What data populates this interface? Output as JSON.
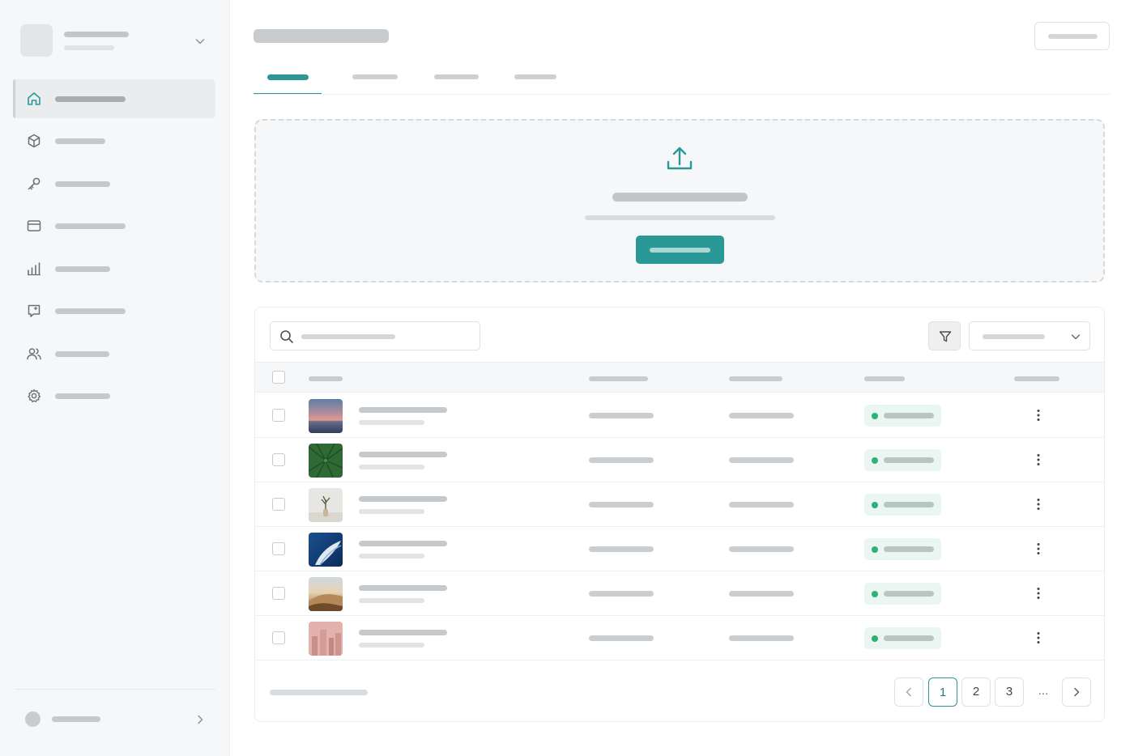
{
  "page": {
    "title": "",
    "primary_action_label": ""
  },
  "sidebar": {
    "workspace": {
      "name": "",
      "subtitle": "",
      "expand_icon": "chevron-down-icon"
    },
    "items": [
      {
        "icon": "home-icon",
        "label": "",
        "active": true
      },
      {
        "icon": "cube-icon",
        "label": "",
        "active": false
      },
      {
        "icon": "key-icon",
        "label": "",
        "active": false
      },
      {
        "icon": "card-icon",
        "label": "",
        "active": false
      },
      {
        "icon": "bar-chart-icon",
        "label": "",
        "active": false
      },
      {
        "icon": "note-icon",
        "label": "",
        "active": false
      },
      {
        "icon": "users-icon",
        "label": "",
        "active": false
      },
      {
        "icon": "gear-icon",
        "label": "",
        "active": false
      }
    ],
    "profile": {
      "name": "",
      "icon": "chevron-right-icon"
    }
  },
  "tabs": [
    {
      "label": "",
      "active": true
    },
    {
      "label": "",
      "active": false
    },
    {
      "label": "",
      "active": false
    },
    {
      "label": "",
      "active": false
    }
  ],
  "upload": {
    "icon": "upload-icon",
    "title": "",
    "subtitle": "",
    "button_label": ""
  },
  "table": {
    "search_placeholder": "",
    "filter_icon": "filter-icon",
    "sort_select_value": "",
    "columns": [
      "",
      "",
      "",
      "",
      ""
    ],
    "status_color": "#2fb077",
    "rows": [
      {
        "thumbnail": "sunset-sea",
        "name": "",
        "meta": "",
        "col2": "",
        "col3": "",
        "status": ""
      },
      {
        "thumbnail": "green-leaf",
        "name": "",
        "meta": "",
        "col2": "",
        "col3": "",
        "status": ""
      },
      {
        "thumbnail": "plant-vase",
        "name": "",
        "meta": "",
        "col2": "",
        "col3": "",
        "status": ""
      },
      {
        "thumbnail": "blue-wave",
        "name": "",
        "meta": "",
        "col2": "",
        "col3": "",
        "status": ""
      },
      {
        "thumbnail": "desert-dune",
        "name": "",
        "meta": "",
        "col2": "",
        "col3": "",
        "status": ""
      },
      {
        "thumbnail": "pink-city",
        "name": "",
        "meta": "",
        "col2": "",
        "col3": "",
        "status": ""
      }
    ],
    "footer_text": "",
    "pagination": {
      "pages": [
        "1",
        "2",
        "3"
      ],
      "current": "1",
      "ellipsis": "...",
      "prev_icon": "chevron-left-icon",
      "next_icon": "chevron-right-icon"
    }
  },
  "colors": {
    "accent": "#2a9897",
    "status_ok": "#2fb077"
  }
}
